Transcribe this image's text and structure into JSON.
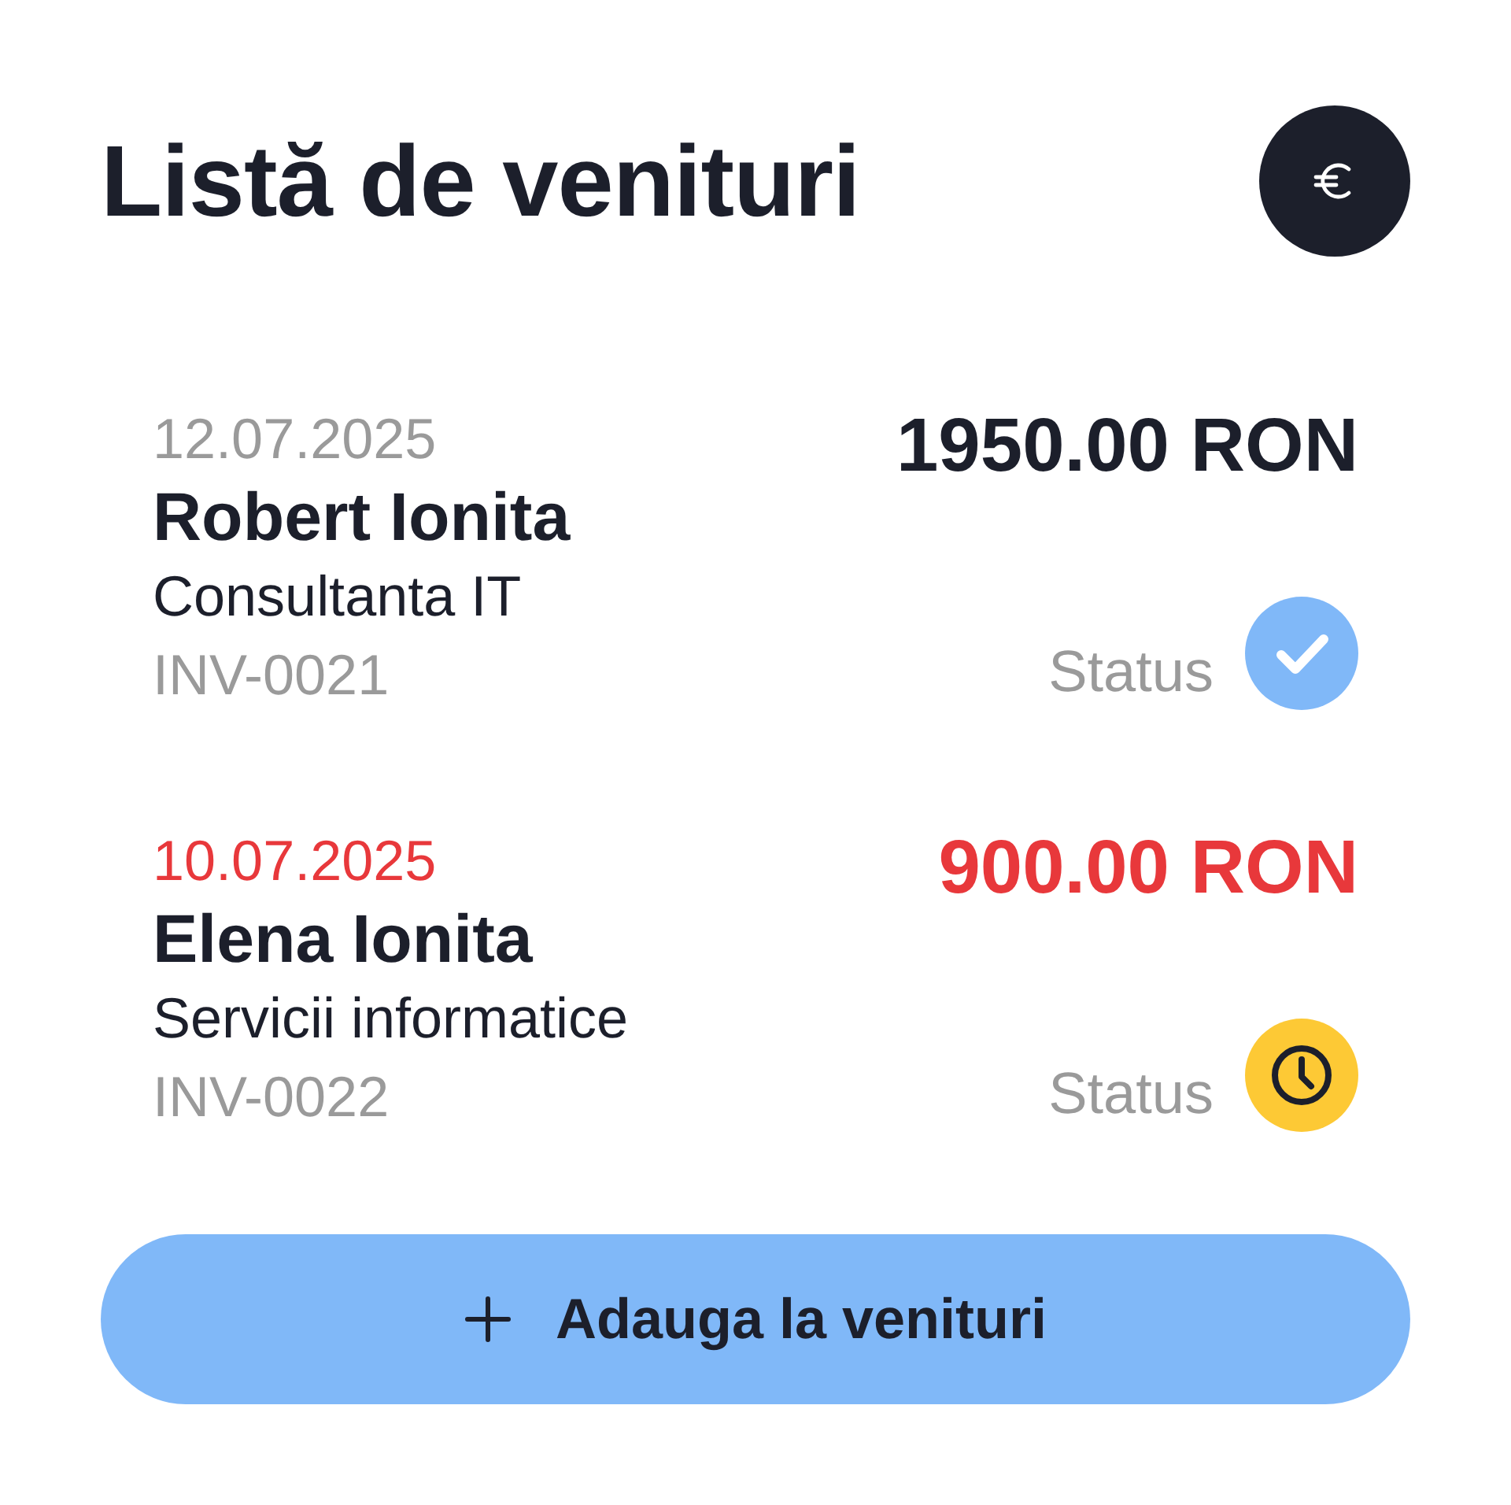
{
  "header": {
    "title": "Listă de venituri"
  },
  "incomes": [
    {
      "date": "12.07.2025",
      "client": "Robert Ionita",
      "description": "Consultanta IT",
      "invoice": "INV-0021",
      "amount": "1950.00 RON",
      "overdue": false,
      "status": {
        "label": "Status",
        "kind": "paid"
      }
    },
    {
      "date": "10.07.2025",
      "client": "Elena Ionita",
      "description": "Servicii informatice",
      "invoice": "INV-0022",
      "amount": "900.00 RON",
      "overdue": true,
      "status": {
        "label": "Status",
        "kind": "pending"
      }
    }
  ],
  "add_button": {
    "label": "Adauga la venituri"
  }
}
